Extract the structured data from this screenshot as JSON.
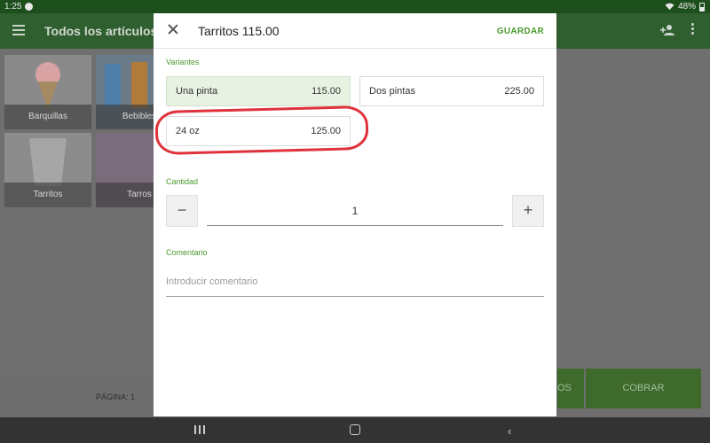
{
  "status_bar": {
    "time": "1:25",
    "battery": "48%"
  },
  "app_bar": {
    "title": "Todos los artículos"
  },
  "items": [
    {
      "label": "Barquillas"
    },
    {
      "label": "Bebibles"
    },
    {
      "label": "Tarritos"
    },
    {
      "label": "Tarros"
    }
  ],
  "footer": {
    "page_label": "PÁGINA: 1",
    "partial_button": "OS",
    "charge_button": "COBRAR"
  },
  "dialog": {
    "title": "Tarritos 115.00",
    "save_label": "GUARDAR",
    "variants_label": "Variantes",
    "variants": [
      {
        "name": "Una pinta",
        "price": "115.00",
        "selected": true
      },
      {
        "name": "Dos pintas",
        "price": "225.00",
        "selected": false
      },
      {
        "name": "24 oz",
        "price": "125.00",
        "selected": false
      }
    ],
    "quantity_label": "Cantidad",
    "quantity_value": "1",
    "minus": "−",
    "plus": "+",
    "comment_label": "Comentario",
    "comment_placeholder": "Introducir comentario"
  },
  "colors": {
    "accent": "#4a9a2c",
    "annotation": "#e0323c"
  },
  "icons": [
    "menu-icon",
    "add-person-icon",
    "more-vert-icon",
    "close-icon",
    "wifi-icon",
    "battery-icon",
    "recents-icon",
    "home-icon",
    "back-icon"
  ]
}
